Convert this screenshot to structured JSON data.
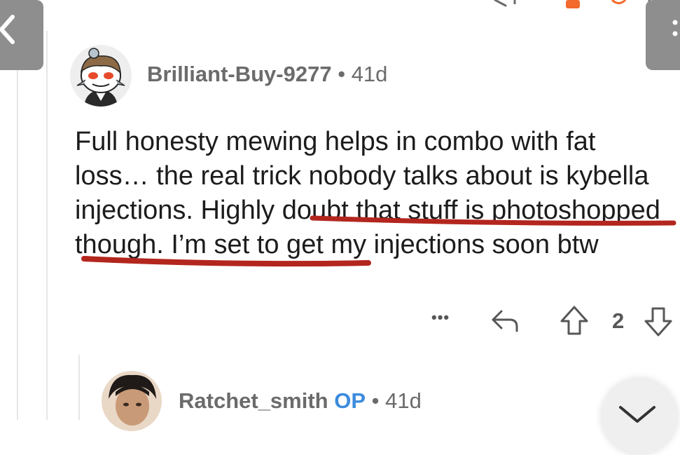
{
  "comment": {
    "username": "Brilliant-Buy-9277",
    "separator": "•",
    "age": "41d",
    "body_before": "Full honesty mewing helps in combo with fat loss… the real trick nobody talks about is kybella injections. ",
    "body_highlight": "Highly doubt that stuff is photoshopped though",
    "body_after": ". I’m set to get my injections soon btw",
    "score": "2",
    "more_label": "•••"
  },
  "reply": {
    "username": "Ratchet_smith",
    "op_badge": "OP",
    "separator": "•",
    "age": "41d"
  },
  "colors": {
    "annotation_underline": "#b3261e",
    "op_badge": "#3c8bdd",
    "meta_text": "#6b6b6b",
    "side_tab": "#8e8e8e"
  },
  "icons": {
    "back": "chevron-left-icon",
    "reply": "reply-arrow-icon",
    "upvote": "upvote-arrow-icon",
    "downvote": "downvote-arrow-icon",
    "collapse": "chevron-down-icon"
  }
}
